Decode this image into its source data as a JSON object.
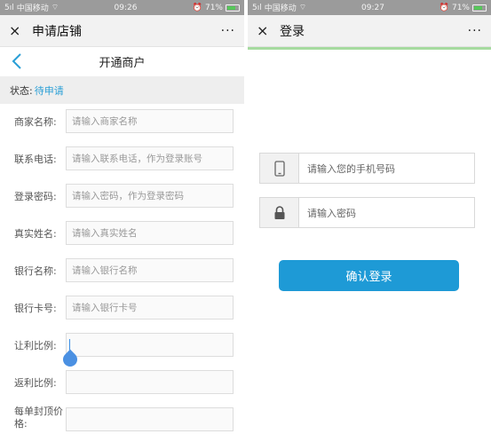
{
  "left": {
    "status": {
      "carrier": "中国移动",
      "time": "09:26",
      "battery": "71%"
    },
    "title": "申请店铺",
    "more": "···",
    "close": "×",
    "nav_title": "开通商户",
    "status_label": "状态:",
    "status_value": "待申请",
    "fields": [
      {
        "label": "商家名称:",
        "placeholder": "请输入商家名称"
      },
      {
        "label": "联系电话:",
        "placeholder": "请输入联系电话，作为登录账号"
      },
      {
        "label": "登录密码:",
        "placeholder": "请输入密码，作为登录密码"
      },
      {
        "label": "真实姓名:",
        "placeholder": "请输入真实姓名"
      },
      {
        "label": "银行名称:",
        "placeholder": "请输入银行名称"
      },
      {
        "label": "银行卡号:",
        "placeholder": "请输入银行卡号"
      },
      {
        "label": "让利比例:",
        "placeholder": ""
      },
      {
        "label": "返利比例:",
        "placeholder": ""
      },
      {
        "label": "每单封顶价格:",
        "placeholder": ""
      }
    ]
  },
  "right": {
    "status": {
      "carrier": "中国移动",
      "time": "09:27",
      "battery": "71%"
    },
    "title": "登录",
    "more": "···",
    "close": "×",
    "phone_placeholder": "请输入您的手机号码",
    "password_placeholder": "请输入密码",
    "login_button": "确认登录"
  },
  "icons": {
    "back": "chevron-left-icon",
    "phone": "mobile-phone-icon",
    "lock": "lock-icon",
    "close": "close-icon",
    "more": "more-icon"
  },
  "colors": {
    "accent": "#1e9ad6",
    "status_value": "#2a9fd6",
    "progress": "#a6dba0"
  }
}
